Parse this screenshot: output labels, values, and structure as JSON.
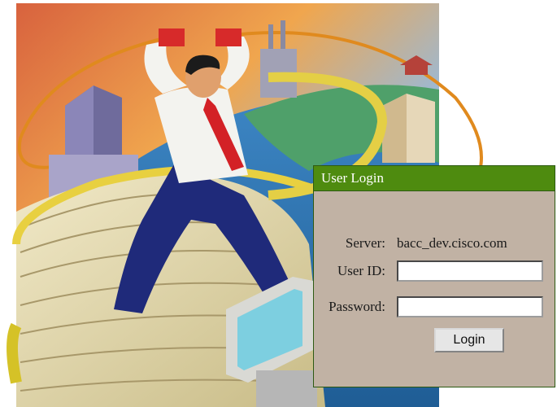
{
  "login": {
    "title": "User Login",
    "server_label": "Server:",
    "server_value": "bacc_dev.cisco.com",
    "userid_label": "User ID:",
    "userid_value": "",
    "password_label": "Password:",
    "password_value": "",
    "login_button": "Login"
  },
  "colors": {
    "header_bg": "#4e8b0f",
    "panel_bg": "#c1b2a4"
  }
}
